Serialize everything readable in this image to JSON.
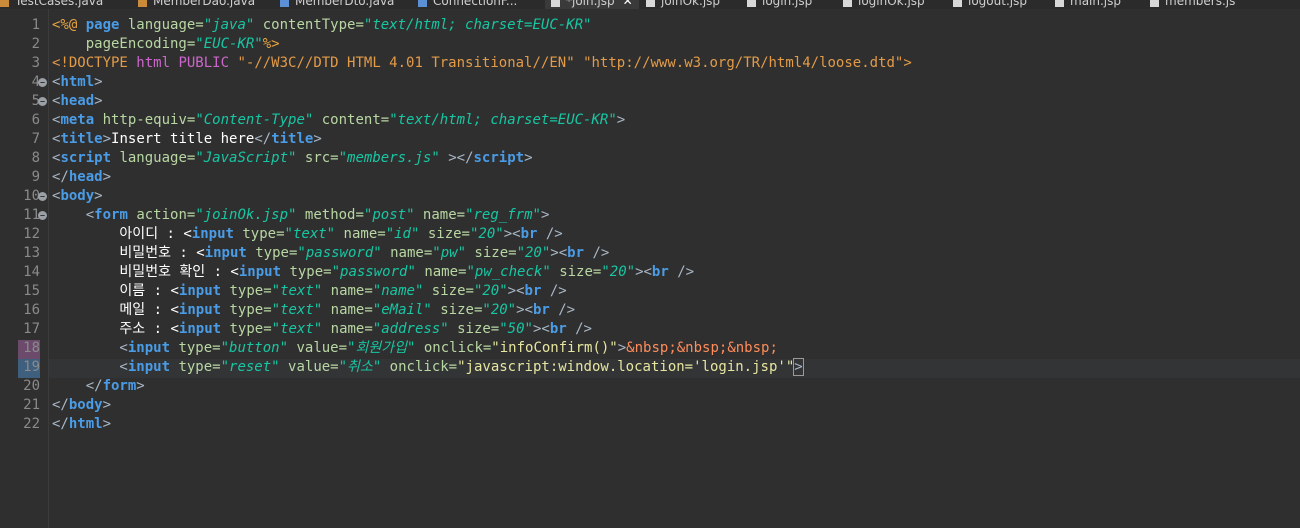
{
  "tabs": [
    {
      "label": "TestCases.java",
      "icon": "java-file-icon"
    },
    {
      "label": "MemberDao.java",
      "icon": "java-file-icon"
    },
    {
      "label": "MemberDto.java",
      "icon": "java-file-icon"
    },
    {
      "label": "ConnectionF...",
      "icon": "java-file-icon"
    },
    {
      "label": "*join.jsp",
      "icon": "jsp-file-icon",
      "active": true
    },
    {
      "label": "joinOk.jsp",
      "icon": "jsp-file-icon"
    },
    {
      "label": "login.jsp",
      "icon": "jsp-file-icon"
    },
    {
      "label": "loginOk.jsp",
      "icon": "jsp-file-icon"
    },
    {
      "label": "logout.jsp",
      "icon": "jsp-file-icon"
    },
    {
      "label": "main.jsp",
      "icon": "jsp-file-icon"
    },
    {
      "label": "members.js",
      "icon": "js-file-icon"
    }
  ],
  "close_glyph": "✕",
  "line_numbers": [
    "1",
    "2",
    "3",
    "4",
    "5",
    "6",
    "7",
    "8",
    "9",
    "10",
    "11",
    "12",
    "13",
    "14",
    "15",
    "16",
    "17",
    "18",
    "19",
    "20",
    "21",
    "22"
  ],
  "code": {
    "l1": [
      "<%@ ",
      "page ",
      "language=",
      "\"java\"",
      " contentType=",
      "\"text/html; charset=EUC-KR\""
    ],
    "l2": [
      "    pageEncoding=",
      "\"EUC-KR\"",
      "%>"
    ],
    "l3": [
      "<!",
      "DOCTYPE ",
      "html ",
      "PUBLIC ",
      "\"-//W3C//DTD HTML 4.01 Transitional//EN\"",
      " ",
      "\"http://www.w3.org/TR/html4/loose.dtd\"",
      ">"
    ],
    "l4": [
      "<",
      "html",
      ">"
    ],
    "l5": [
      "<",
      "head",
      ">"
    ],
    "l6": [
      "<",
      "meta ",
      "http-equiv=",
      "\"Content-Type\"",
      " content=",
      "\"text/html; charset=EUC-KR\"",
      ">"
    ],
    "l7": [
      "<",
      "title",
      ">",
      "Insert title here",
      "</",
      "title",
      ">"
    ],
    "l8": [
      "<",
      "script ",
      "language=",
      "\"JavaScript\"",
      " src=",
      "\"members.js\"",
      " ></",
      "script",
      ">"
    ],
    "l9": [
      "</",
      "head",
      ">"
    ],
    "l10": [
      "<",
      "body",
      ">"
    ],
    "l11": [
      "    <",
      "form ",
      "action=",
      "\"joinOk.jsp\"",
      " method=",
      "\"post\"",
      " name=",
      "\"reg_frm\"",
      ">"
    ],
    "l12": [
      "        아이디 : <",
      "input ",
      "type=",
      "\"text\"",
      " name=",
      "\"id\"",
      " size=",
      "\"20\"",
      "><",
      "br",
      " />"
    ],
    "l13": [
      "        비밀번호 : <",
      "input ",
      "type=",
      "\"password\"",
      " name=",
      "\"pw\"",
      " size=",
      "\"20\"",
      "><",
      "br",
      " />"
    ],
    "l14": [
      "        비밀번호 확인 : <",
      "input ",
      "type=",
      "\"password\"",
      " name=",
      "\"pw_check\"",
      " size=",
      "\"20\"",
      "><",
      "br",
      " />"
    ],
    "l15": [
      "        이름 : <",
      "input ",
      "type=",
      "\"text\"",
      " name=",
      "\"name\"",
      " size=",
      "\"20\"",
      "><",
      "br",
      " />"
    ],
    "l16": [
      "        메일 : <",
      "input ",
      "type=",
      "\"text\"",
      " name=",
      "\"eMail\"",
      " size=",
      "\"20\"",
      "><",
      "br",
      " />"
    ],
    "l17": [
      "        주소 : <",
      "input ",
      "type=",
      "\"text\"",
      " name=",
      "\"address\"",
      " size=",
      "\"50\"",
      "><",
      "br",
      " />"
    ],
    "l18": [
      "        <",
      "input ",
      "type=",
      "\"button\"",
      " value=",
      "\"회원가입\"",
      " onclick=",
      "\"infoConfirm()\"",
      ">",
      "&nbsp;&nbsp;&nbsp;"
    ],
    "l19": [
      "        <",
      "input ",
      "type=",
      "\"reset\"",
      " value=",
      "\"취소\"",
      " onclick=",
      "\"javascript:window.location='login.jsp'\"",
      ">"
    ],
    "l20": [
      "    </",
      "form",
      ">"
    ],
    "l21": [
      "</",
      "body",
      ">"
    ],
    "l22": [
      "</",
      "html",
      ">"
    ]
  },
  "colors": {
    "background": "#2f2f2f",
    "keyword": "#4a9ce6",
    "attribute": "#b8d7a3",
    "string": "#17c6a3",
    "directive": "#e8a441"
  }
}
